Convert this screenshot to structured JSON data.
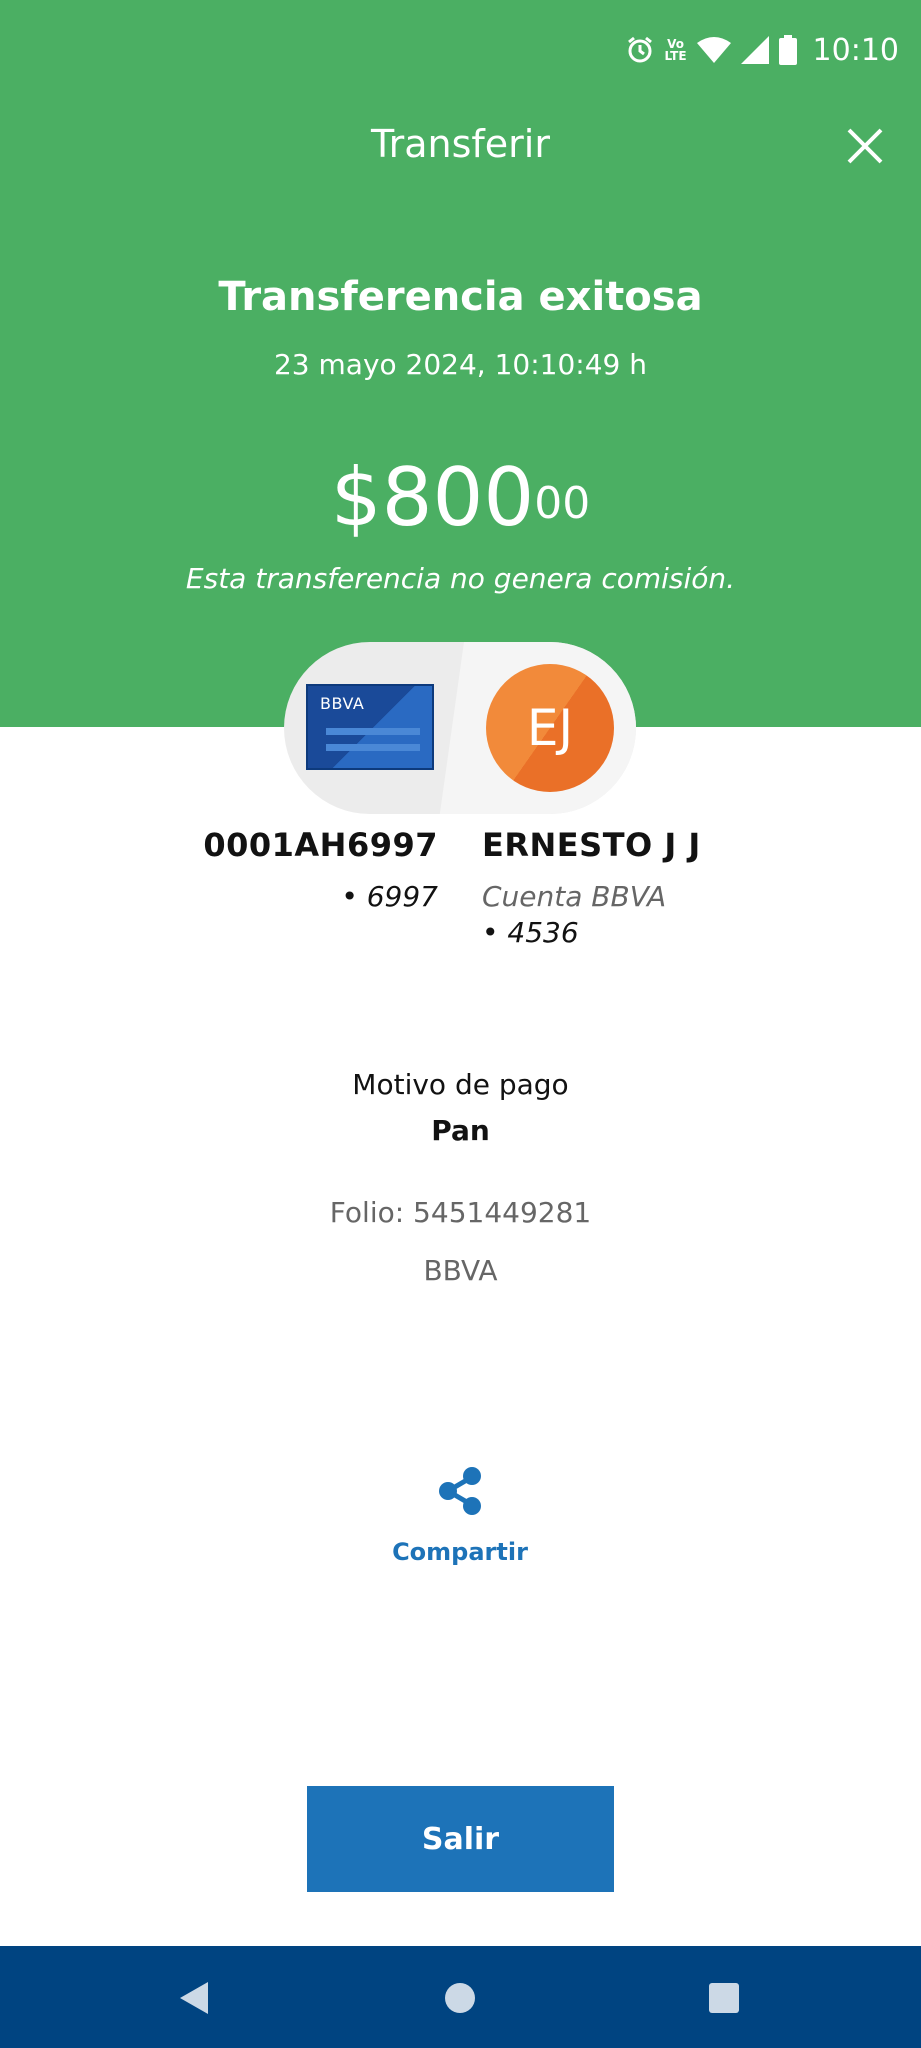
{
  "status_bar": {
    "time": "10:10",
    "network_label": "LTE",
    "icons": [
      "alarm-icon",
      "volte-icon",
      "wifi-icon",
      "signal-icon",
      "battery-icon"
    ]
  },
  "header": {
    "title": "Transferir",
    "close_icon": "close-icon"
  },
  "result": {
    "title": "Transferencia exitosa",
    "datetime": "23 mayo 2024, 10:10:49 h",
    "amount_main": "$800",
    "amount_cents": "00",
    "commission_note": "Esta transferencia no genera comisión."
  },
  "transfer": {
    "origin": {
      "card_brand": "BBVA",
      "account": "0001AH6997",
      "last_digits": "• 6997"
    },
    "destination": {
      "initials": "EJ",
      "name": "ERNESTO J J",
      "account_type": "Cuenta BBVA",
      "last_digits": "• 4536"
    }
  },
  "details": {
    "reason_label": "Motivo de pago",
    "reason_value": "Pan",
    "folio": "Folio: 5451449281",
    "bank": "BBVA"
  },
  "actions": {
    "share_label": "Compartir",
    "share_icon": "share-icon",
    "exit_label": "Salir"
  },
  "nav_bar": {
    "icons": [
      "back-icon",
      "home-icon",
      "recents-icon"
    ]
  },
  "colors": {
    "header_green": "#4baf63",
    "primary_blue": "#1d73b8",
    "nav_blue": "#004481",
    "avatar_orange": "#f28a3a",
    "card_blue": "#1a4a99"
  }
}
